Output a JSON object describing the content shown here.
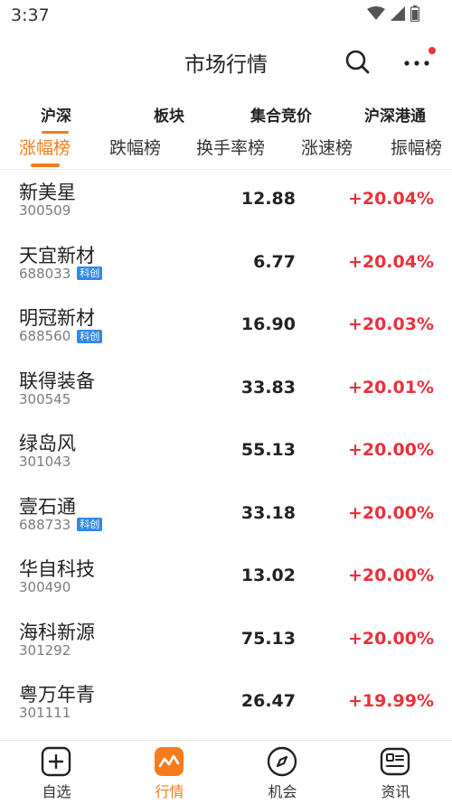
{
  "status": {
    "time": "3:37"
  },
  "header": {
    "title": "市场行情",
    "search_icon": "search-icon",
    "more_icon": "more-dots-icon"
  },
  "colors": {
    "accent": "#f57b1d",
    "up": "#e8323c",
    "badge": "#2f8ae6"
  },
  "categories": [
    "沪深",
    "板块",
    "集合竞价",
    "沪深港通"
  ],
  "active_category": "沪深",
  "sub_tabs": [
    "涨幅榜",
    "跌幅榜",
    "换手率榜",
    "涨速榜",
    "振幅榜"
  ],
  "active_sub_tab": "涨幅榜",
  "stocks": [
    {
      "name": "新美星",
      "code": "300509",
      "badge": "",
      "price": "12.88",
      "change": "+20.04%"
    },
    {
      "name": "天宜新材",
      "code": "688033",
      "badge": "科创",
      "price": "6.77",
      "change": "+20.04%"
    },
    {
      "name": "明冠新材",
      "code": "688560",
      "badge": "科创",
      "price": "16.90",
      "change": "+20.03%"
    },
    {
      "name": "联得装备",
      "code": "300545",
      "badge": "",
      "price": "33.83",
      "change": "+20.01%"
    },
    {
      "name": "绿岛风",
      "code": "301043",
      "badge": "",
      "price": "55.13",
      "change": "+20.00%"
    },
    {
      "name": "壹石通",
      "code": "688733",
      "badge": "科创",
      "price": "33.18",
      "change": "+20.00%"
    },
    {
      "name": "华自科技",
      "code": "300490",
      "badge": "",
      "price": "13.02",
      "change": "+20.00%"
    },
    {
      "name": "海科新源",
      "code": "301292",
      "badge": "",
      "price": "75.13",
      "change": "+20.00%"
    },
    {
      "name": "粤万年青",
      "code": "301111",
      "badge": "",
      "price": "26.47",
      "change": "+19.99%"
    }
  ],
  "bottom_nav": [
    {
      "label": "自选",
      "icon": "add-watchlist-icon"
    },
    {
      "label": "行情",
      "icon": "market-trend-icon"
    },
    {
      "label": "机会",
      "icon": "compass-icon"
    },
    {
      "label": "资讯",
      "icon": "news-icon"
    }
  ],
  "active_nav": "行情"
}
